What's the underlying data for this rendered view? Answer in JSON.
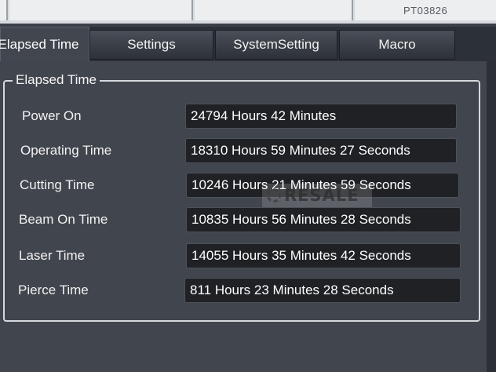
{
  "header": {
    "device_id": "PT03826"
  },
  "tabs": [
    {
      "label": "Elapsed Time",
      "active": true
    },
    {
      "label": "Settings",
      "active": false
    },
    {
      "label": "SystemSetting",
      "active": false
    },
    {
      "label": "Macro",
      "active": false
    }
  ],
  "group": {
    "title": "Elapsed Time",
    "rows": [
      {
        "label": "Power On",
        "value": "24794 Hours 42 Minutes"
      },
      {
        "label": "Operating Time",
        "value": "18310 Hours 59 Minutes 27 Seconds"
      },
      {
        "label": "Cutting Time",
        "value": "10246 Hours 21 Minutes 59 Seconds"
      },
      {
        "label": "Beam On Time",
        "value": "10835 Hours 56 Minutes 28 Seconds"
      },
      {
        "label": "Laser Time",
        "value": "14055 Hours 35 Minutes 42 Seconds"
      },
      {
        "label": "Pierce Time",
        "value": "811 Hours 23 Minutes 28 Seconds"
      }
    ]
  },
  "watermark": {
    "text": "RESALE"
  },
  "colors": {
    "panel_bg": "#41454d",
    "field_bg": "#1f2125",
    "text": "#f2f2f2"
  }
}
